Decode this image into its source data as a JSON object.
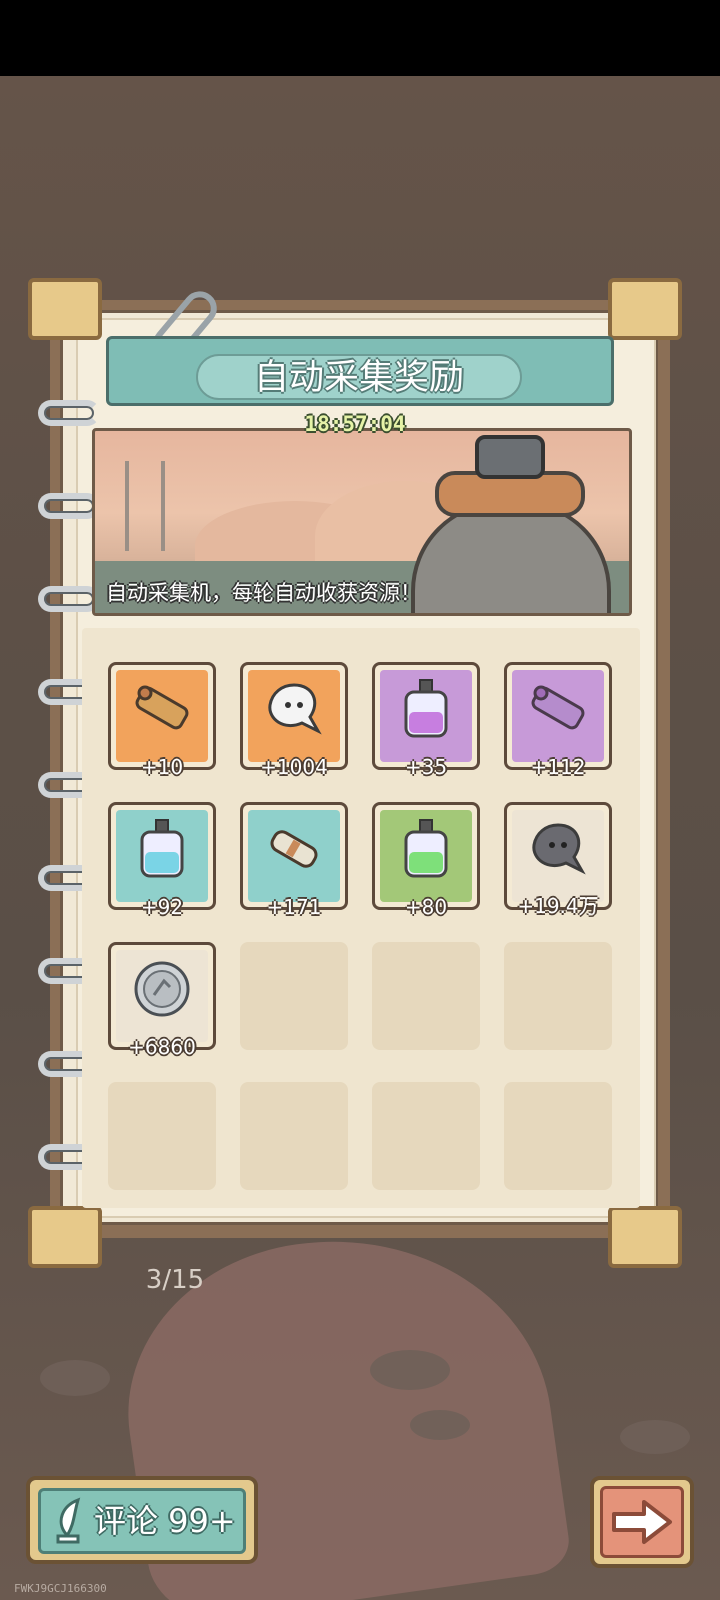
{
  "header": {
    "title": "自动采集奖励",
    "timer": "18:57:04"
  },
  "scene": {
    "caption": "自动采集机，每轮自动收获资源！"
  },
  "rewards": [
    {
      "quantity": "+10",
      "icon": "scroll-cannon-icon",
      "bg": "#f2a35c"
    },
    {
      "quantity": "+1004",
      "icon": "white-blob-icon",
      "bg": "#f2a35c"
    },
    {
      "quantity": "+35",
      "icon": "purple-potion-icon",
      "bg": "#c79ad8"
    },
    {
      "quantity": "+112",
      "icon": "purple-cannon-icon",
      "bg": "#c79ad8"
    },
    {
      "quantity": "+92",
      "icon": "blue-potion-icon",
      "bg": "#8fd0cb"
    },
    {
      "quantity": "+171",
      "icon": "scroll-icon",
      "bg": "#8fd0cb"
    },
    {
      "quantity": "+80",
      "icon": "green-potion-icon",
      "bg": "#a3c878"
    },
    {
      "quantity": "+19.4万",
      "icon": "gray-blob-icon",
      "bg": "#ede4d4"
    },
    {
      "quantity": "+6860",
      "icon": "silver-coin-icon",
      "bg": "#ede4d4"
    }
  ],
  "pagination": {
    "label": "3/15"
  },
  "bottom": {
    "comment_label": "评论 99+"
  },
  "watermark": "FWKJ9GCJ166300",
  "colors": {
    "banner": "#7fbdb5",
    "paper": "#f1e9d6",
    "frame": "#8b6f56"
  }
}
